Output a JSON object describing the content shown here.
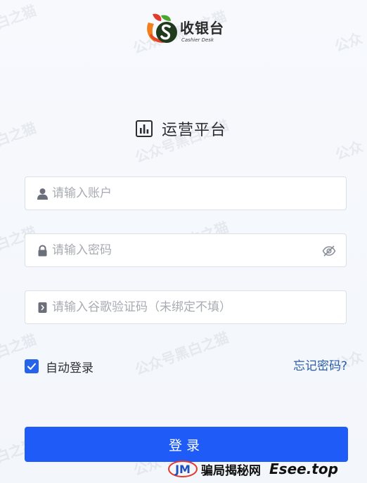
{
  "brand": {
    "name": "收银台",
    "subtitle": "Cashier Desk",
    "logo_letter": "S"
  },
  "heading": {
    "title": "运营平台"
  },
  "form": {
    "account": {
      "placeholder": "请输入账户",
      "value": ""
    },
    "password": {
      "placeholder": "请输入密码",
      "value": ""
    },
    "code": {
      "placeholder": "请输入谷歌验证码（未绑定不填）",
      "value": ""
    }
  },
  "remember": {
    "label": "自动登录",
    "checked": true
  },
  "forgot_password": {
    "label": "忘记密码?"
  },
  "login_button": {
    "label": "登录"
  },
  "watermark": {
    "text_a": "公众号黑白之猫",
    "text_b": "白之猫",
    "text_c": "公众"
  },
  "badge": {
    "logo": "JM",
    "text": "骗局揭秘网",
    "site": "Esee.top"
  },
  "colors": {
    "primary": "#1f5cf7",
    "link": "#2a5caa",
    "checkbox": "#2563eb",
    "placeholder": "#a8abb2"
  }
}
